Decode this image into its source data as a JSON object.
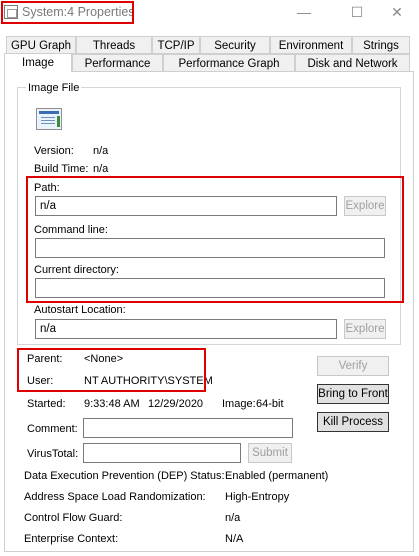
{
  "window": {
    "title": "System:4 Properties",
    "minimize_glyph": "—",
    "maximize_glyph": "☐",
    "close_glyph": "✕"
  },
  "tabs_row1": [
    "GPU Graph",
    "Threads",
    "TCP/IP",
    "Security",
    "Environment",
    "Strings"
  ],
  "tabs_row2": [
    "Image",
    "Performance",
    "Performance Graph",
    "Disk and Network"
  ],
  "active_tab": "Image",
  "image_file": {
    "group_label": "Image File",
    "icon": "application-window-icon",
    "version_label": "Version:",
    "version_value": "n/a",
    "build_time_label": "Build Time:",
    "build_time_value": "n/a",
    "path_label": "Path:",
    "path_value": "n/a",
    "explore_label": "Explore",
    "command_line_label": "Command line:",
    "command_line_value": "",
    "current_directory_label": "Current directory:",
    "current_directory_value": "",
    "autostart_label": "Autostart Location:",
    "autostart_value": "n/a",
    "explore2_label": "Explore"
  },
  "process": {
    "parent_label": "Parent:",
    "parent_value": "<None>",
    "user_label": "User:",
    "user_value": "NT AUTHORITY\\SYSTEM",
    "started_label": "Started:",
    "started_time": "9:33:48 AM",
    "started_date": "12/29/2020",
    "image_label": "Image:",
    "image_value": "64-bit",
    "comment_label": "Comment:",
    "comment_value": "",
    "virustotal_label": "VirusTotal:",
    "virustotal_value": "",
    "submit_label": "Submit"
  },
  "buttons": {
    "verify": "Verify",
    "bring_to_front": "Bring to Front",
    "kill_process": "Kill Process"
  },
  "security_info": {
    "dep_label": "Data Execution Prevention (DEP) Status:",
    "dep_value": "Enabled (permanent)",
    "aslr_label": "Address Space Load Randomization:",
    "aslr_value": "High-Entropy",
    "cfg_label": "Control Flow Guard:",
    "cfg_value": "n/a",
    "enterprise_label": "Enterprise Context:",
    "enterprise_value": "N/A"
  },
  "colors": {
    "highlight": "#e00000",
    "disabled_text": "#a0a0a0"
  }
}
